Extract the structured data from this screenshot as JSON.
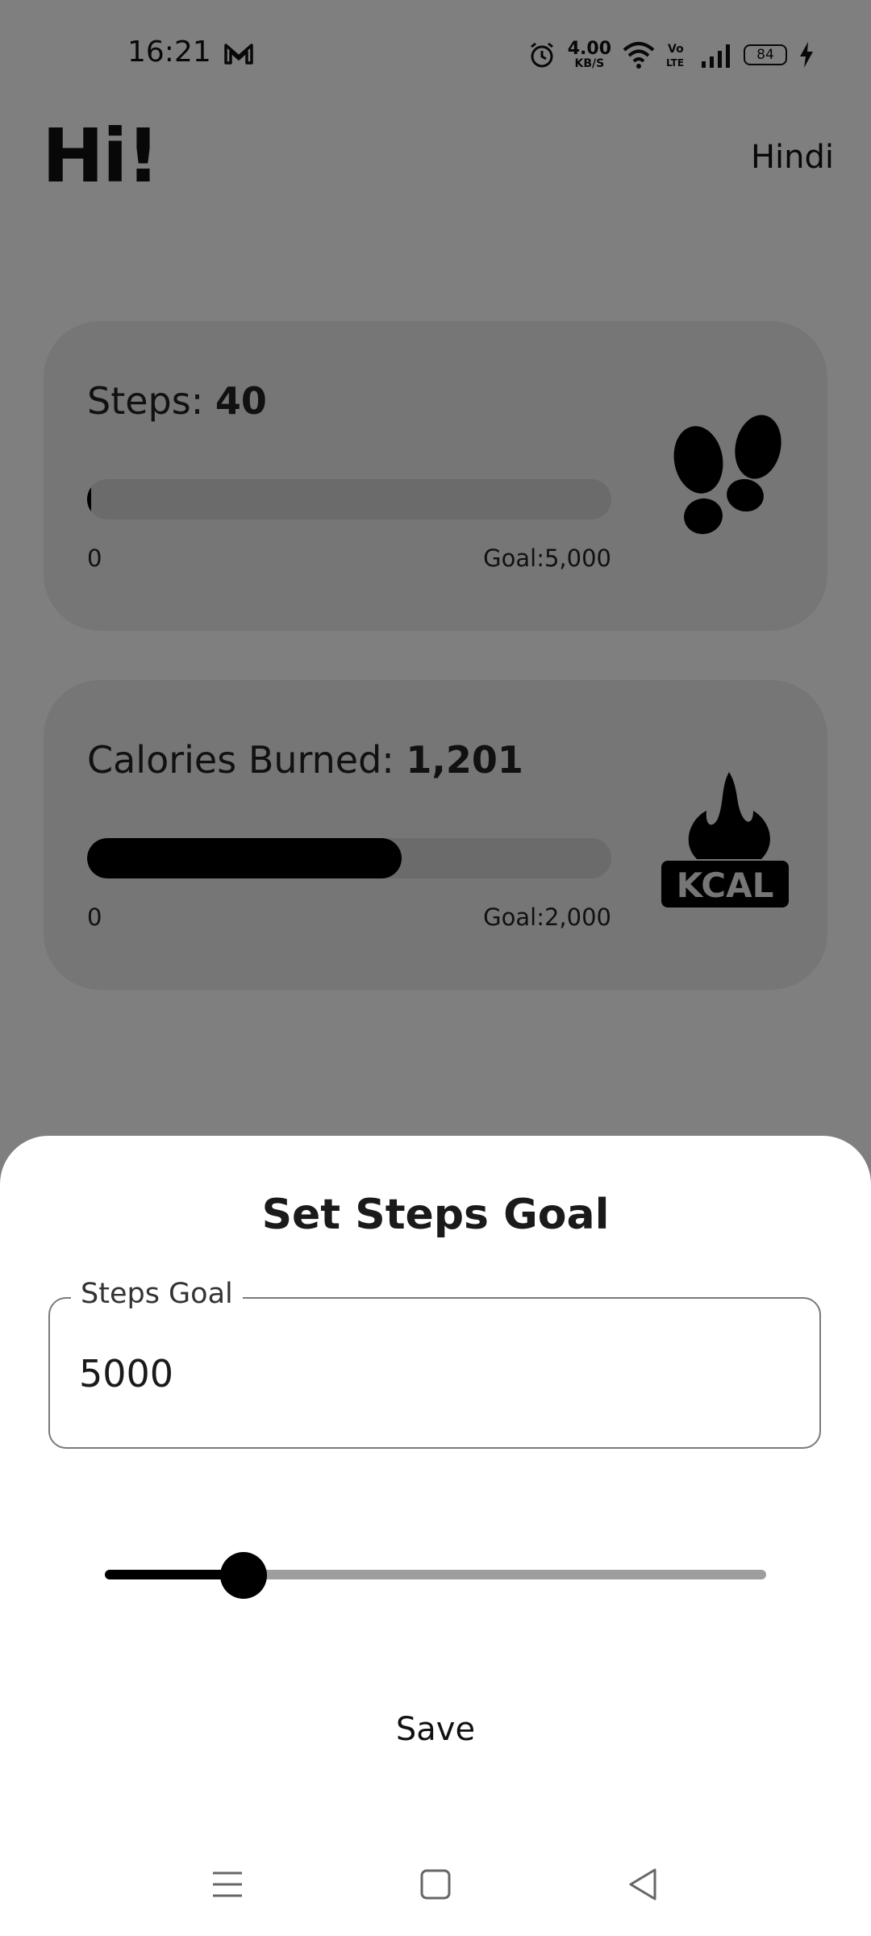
{
  "status_bar": {
    "time": "16:21",
    "net_speed_value": "4.00",
    "net_speed_unit": "KB/S",
    "battery": "84",
    "icons": [
      "gmail-icon",
      "alarm-icon",
      "wifi-icon",
      "volte-icon",
      "signal-icon",
      "battery-icon",
      "charging-icon"
    ]
  },
  "header": {
    "greeting": "Hi!",
    "language_link": "Hindi"
  },
  "steps_card": {
    "label": "Steps:",
    "value": "40",
    "progress_fraction": 0.008,
    "start_label": "0",
    "goal_label": "Goal:5,000",
    "icon": "footprints-icon"
  },
  "calories_card": {
    "label": "Calories Burned:",
    "value": "1,201",
    "progress_fraction": 0.6,
    "start_label": "0",
    "goal_label": "Goal:2,000",
    "icon": "kcal-flame-icon",
    "icon_text": "KCAL"
  },
  "sheet": {
    "title": "Set Steps Goal",
    "field_label": "Steps Goal",
    "field_value": "5000",
    "slider_fraction": 0.21,
    "save_label": "Save"
  },
  "nav_bar": {
    "icons": [
      "menu-icon",
      "home-icon",
      "back-icon"
    ]
  },
  "colors": {
    "accent": "#000000",
    "card_bg": "#ececec",
    "track": "#d6d6d6",
    "scrim": "rgba(0,0,0,0.5)"
  }
}
